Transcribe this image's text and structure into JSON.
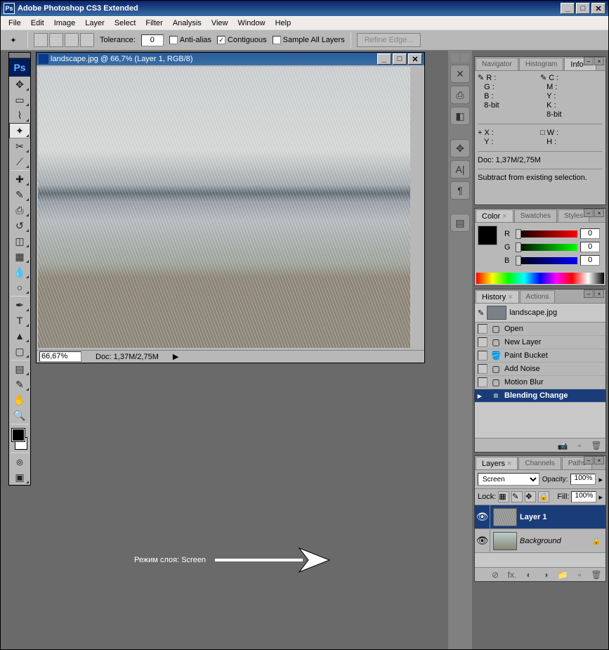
{
  "window": {
    "title": "Adobe Photoshop CS3 Extended",
    "ps_abbr": "Ps"
  },
  "menu": {
    "file": "File",
    "edit": "Edit",
    "image": "Image",
    "layer": "Layer",
    "select": "Select",
    "filter": "Filter",
    "analysis": "Analysis",
    "view": "View",
    "window": "Window",
    "help": "Help"
  },
  "options": {
    "tolerance_label": "Tolerance:",
    "tolerance_value": "0",
    "antialias": "Anti-alias",
    "contiguous": "Contiguous",
    "contiguous_checked": "✓",
    "sample_all": "Sample All Layers",
    "refine": "Refine Edge..."
  },
  "document": {
    "title": "landscape.jpg @ 66,7% (Layer 1, RGB/8)",
    "zoom": "66,67%",
    "docsize": "Doc: 1,37M/2,75M"
  },
  "annotation": {
    "text": "Режим слоя: Screen"
  },
  "info_panel": {
    "tabs": {
      "navigator": "Navigator",
      "histogram": "Histogram",
      "info": "Info"
    },
    "r": "R :",
    "g": "G :",
    "b": "B :",
    "bit1": "8-bit",
    "c": "C :",
    "m": "M :",
    "y": "Y :",
    "k": "K :",
    "bit2": "8-bit",
    "px": "X :",
    "py": "Y :",
    "w": "W :",
    "h": "H :",
    "docsize": "Doc: 1,37M/2,75M",
    "hint": "Subtract from existing selection."
  },
  "color_panel": {
    "tabs": {
      "color": "Color",
      "swatches": "Swatches",
      "styles": "Styles"
    },
    "r": "R",
    "g": "G",
    "b": "B",
    "r_val": "0",
    "g_val": "0",
    "b_val": "0"
  },
  "history_panel": {
    "tabs": {
      "history": "History",
      "actions": "Actions"
    },
    "file": "landscape.jpg",
    "items": {
      "open": "Open",
      "newlayer": "New Layer",
      "paintbucket": "Paint Bucket",
      "addnoise": "Add Noise",
      "motionblur": "Motion Blur",
      "blending": "Blending Change"
    }
  },
  "layers_panel": {
    "tabs": {
      "layers": "Layers",
      "channels": "Channels",
      "paths": "Paths"
    },
    "blend_mode": "Screen",
    "opacity_label": "Opacity:",
    "opacity_value": "100%",
    "lock_label": "Lock:",
    "fill_label": "Fill:",
    "fill_value": "100%",
    "layer1": "Layer 1",
    "background": "Background"
  }
}
